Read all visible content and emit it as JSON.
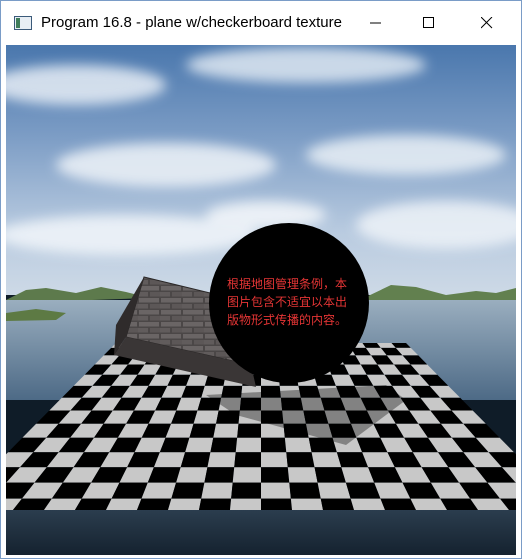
{
  "window": {
    "title": "Program 16.8 - plane w/checkerboard texture",
    "icon": "app-window-icon",
    "controls": [
      "minimize-icon",
      "maximize-icon",
      "close-icon"
    ]
  },
  "scene": {
    "checkerboard_light": "#c8c8c8",
    "checkerboard_dark": "#000000",
    "sky_color": "#3c6aa0",
    "water_color": "#6f8aa3",
    "notice_circle_color": "#000000",
    "notice_text_color": "#e53535"
  },
  "notice": {
    "text": "根据地图管理条例，本\n图片包含不适宜以本出\n版物形式传播的内容。"
  }
}
